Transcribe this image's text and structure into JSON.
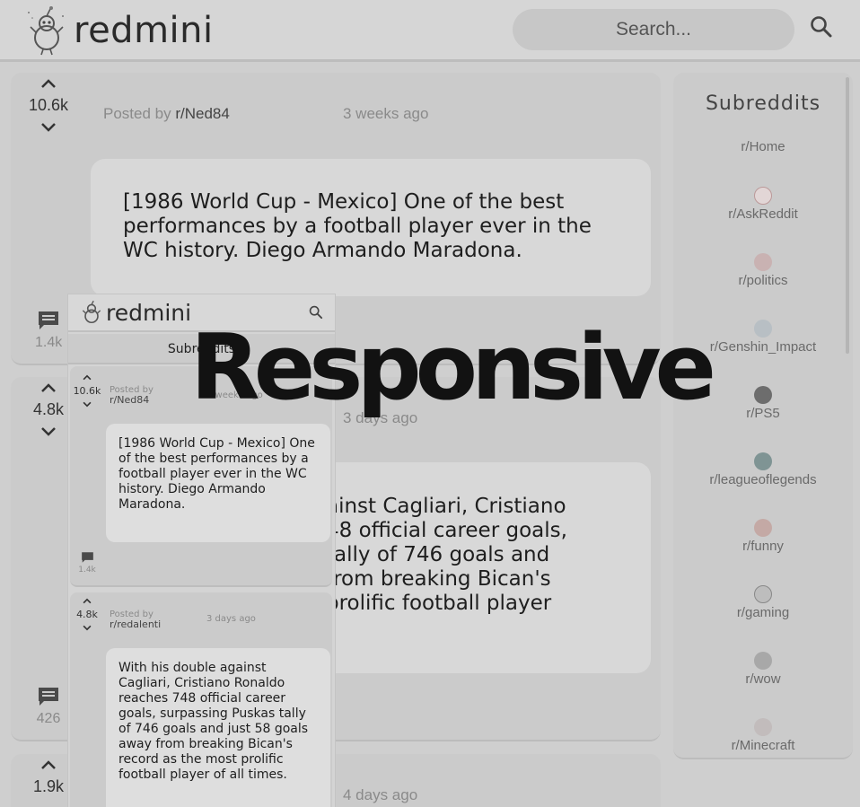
{
  "header": {
    "logo_text": "redmini",
    "search_placeholder": "Search..."
  },
  "posts": [
    {
      "score": "10.6k",
      "posted_by_prefix": "Posted by",
      "author": "r/Ned84",
      "time": "3 weeks ago",
      "text": "[1986 World Cup - Mexico] One of the best performances by a football player ever in the WC history. Diego Armando Maradona.",
      "comments": "1.4k"
    },
    {
      "score": "4.8k",
      "time": "3 days ago",
      "text_visible_lines": [
        "ainst Cagliari, Cristiano",
        "48 official career goals,",
        "tally of 746 goals and",
        "from breaking Bican's",
        "prolific football player"
      ],
      "comments": "426"
    },
    {
      "score": "1.9k",
      "time": "4 days ago"
    }
  ],
  "sidebar": {
    "title": "Subreddits",
    "items": [
      {
        "label": "r/Home",
        "icon": "home-icon"
      },
      {
        "label": "r/AskReddit",
        "icon": "askreddit-icon"
      },
      {
        "label": "r/politics",
        "icon": "politics-icon"
      },
      {
        "label": "r/Genshin_Impact",
        "icon": "genshin-icon"
      },
      {
        "label": "r/PS5",
        "icon": "playstation-icon"
      },
      {
        "label": "r/leagueoflegends",
        "icon": "league-icon"
      },
      {
        "label": "r/funny",
        "icon": "funny-icon"
      },
      {
        "label": "r/gaming",
        "icon": "gaming-icon"
      },
      {
        "label": "r/wow",
        "icon": "wow-icon"
      },
      {
        "label": "r/Minecraft",
        "icon": "minecraft-icon"
      }
    ]
  },
  "mobile": {
    "logo_text": "redmini",
    "subreddits_label": "Subreddits",
    "posts": [
      {
        "score": "10.6k",
        "posted_by_prefix": "Posted by",
        "author": "r/Ned84",
        "time": "3 weeks ago",
        "text": "[1986 World Cup - Mexico] One of the best performances by a football player ever in the WC history. Diego Armando Maradona.",
        "comments": "1.4k"
      },
      {
        "score": "4.8k",
        "posted_by_prefix": "Posted by",
        "author": "r/redalenti",
        "time": "3 days ago",
        "text": "With his double against Cagliari, Cristiano Ronaldo reaches 748 official career goals, surpassing Puskas tally of 746 goals and just 58 goals away from breaking Bican's record as the most prolific football player of all times."
      }
    ]
  },
  "headline": "Responsive",
  "colors": {
    "background": "#cfcfcf",
    "card": "#cbcbcb",
    "text_card": "#d8d8d8"
  }
}
